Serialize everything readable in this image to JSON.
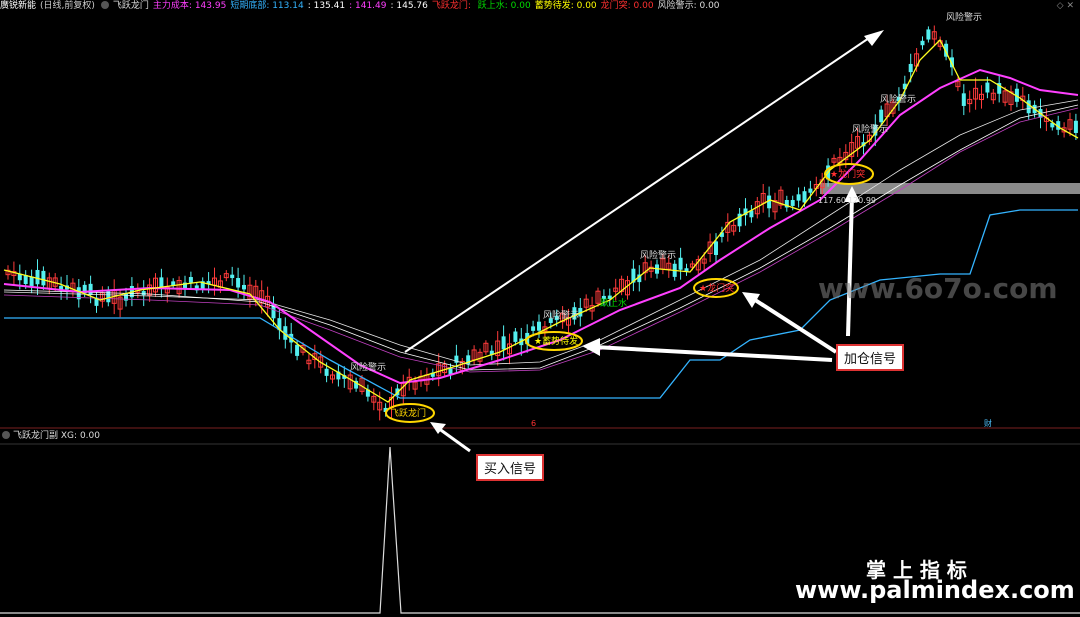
{
  "header": {
    "stock": "廣锐新能",
    "period": "(日线,前复权)",
    "indicator": "飞跃龙门",
    "items": [
      {
        "label": "主力成本:",
        "value": "143.95",
        "color": "#ff40ff"
      },
      {
        "label": "短期底部:",
        "value": "113.14",
        "color": "#34b4ff"
      },
      {
        "label": ":",
        "value": "135.41",
        "color": "#ffffff"
      },
      {
        "label": ":",
        "value": "141.49",
        "color": "#ff40ff"
      },
      {
        "label": ":",
        "value": "145.76",
        "color": "#ffffff"
      },
      {
        "label": "飞跃龙门:",
        "value": "",
        "color": "#ff3030"
      },
      {
        "label": "跃上水:",
        "value": "0.00",
        "color": "#00dd00"
      },
      {
        "label": "蓄势待发:",
        "value": "0.00",
        "color": "#ffff00"
      },
      {
        "label": "龙门突:",
        "value": "0.00",
        "color": "#ff3030"
      },
      {
        "label": "风险警示:",
        "value": "0.00",
        "color": "#dddddd"
      }
    ]
  },
  "subheader": {
    "name": "飞跃龙门副",
    "xg_label": "XG:",
    "xg_value": "0.00"
  },
  "annotations": {
    "risk1": "风险警示",
    "risk2": "风险警示",
    "risk3": "风险警示",
    "risk4": "风险警示",
    "risk5": "风险警示",
    "risk6": "风险警示",
    "jump_water": "跃上水",
    "surge": "★蓄势待发",
    "dragon_gate_1": "★龙门突",
    "dragon_gate_2": "★龙门突",
    "leap": "飞跃龙门",
    "price_low": "117.60",
    "price_high": "120.99",
    "mark_6": "6",
    "mark_cai": "财"
  },
  "callouts": {
    "buy": "买入信号",
    "add": "加仓信号"
  },
  "watermarks": {
    "site1": "www.6o7o.com",
    "brand": "掌 上 指 标",
    "site2": "www.palmindex.com"
  },
  "chart_data": {
    "type": "candlestick",
    "panels": [
      "main price",
      "飞跃龙门副 XG"
    ],
    "main_series": [
      {
        "name": "主力成本",
        "color": "#ff40ff",
        "last": 143.95
      },
      {
        "name": "短期底部",
        "color": "#34b4ff",
        "last": 113.14
      },
      {
        "name": "",
        "color": "#ffffff",
        "last": 135.41
      },
      {
        "name": "",
        "color": "#ff40ff",
        "last": 141.49
      },
      {
        "name": "",
        "color": "#ffffff",
        "last": 145.76
      }
    ],
    "sub_series": {
      "name": "XG",
      "last": 0.0,
      "signal": "single spike at buy signal"
    },
    "signals": [
      "飞跃龙门",
      "蓄势待发",
      "龙门突",
      "龙门突",
      "跃上水",
      "风险警示"
    ]
  }
}
